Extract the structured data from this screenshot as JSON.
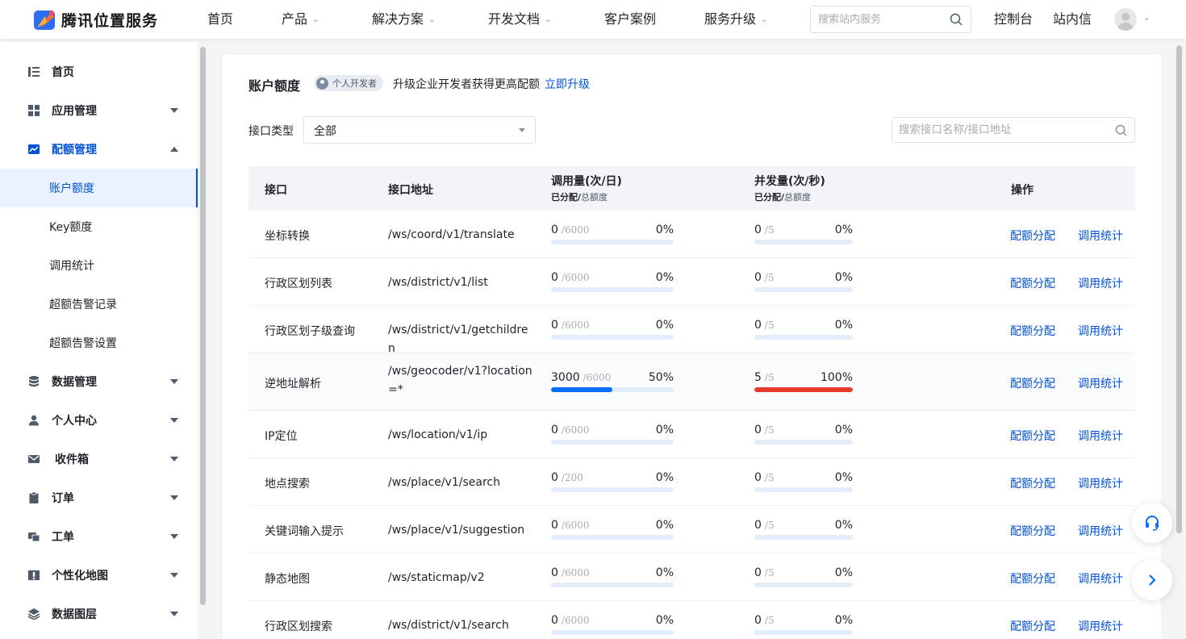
{
  "brand": {
    "name": "腾讯位置服务"
  },
  "topnav": {
    "items": [
      {
        "label": "首页",
        "has_dropdown": false
      },
      {
        "label": "产品",
        "has_dropdown": true
      },
      {
        "label": "解决方案",
        "has_dropdown": true
      },
      {
        "label": "开发文档",
        "has_dropdown": true
      },
      {
        "label": "客户案例",
        "has_dropdown": false
      },
      {
        "label": "服务升级",
        "has_dropdown": true
      }
    ],
    "search_placeholder": "搜索站内服务",
    "console_label": "控制台",
    "inbox_label": "站内信"
  },
  "sidebar": {
    "items": [
      {
        "label": "首页",
        "icon": "list-icon"
      },
      {
        "label": "应用管理",
        "icon": "grid-icon"
      },
      {
        "label": "配额管理",
        "icon": "quota-chart-icon",
        "expanded": true
      },
      {
        "label": "数据管理",
        "icon": "database-icon"
      },
      {
        "label": "个人中心",
        "icon": "user-icon"
      },
      {
        "label": "收件箱",
        "icon": "mail-icon"
      },
      {
        "label": "订单",
        "icon": "clipboard-icon"
      },
      {
        "label": "工单",
        "icon": "ticket-icon"
      },
      {
        "label": "个性化地图",
        "icon": "custom-map-icon"
      },
      {
        "label": "数据图层",
        "icon": "layers-icon"
      }
    ],
    "subitems": [
      {
        "label": "账户额度",
        "active": true
      },
      {
        "label": "Key额度"
      },
      {
        "label": "调用统计"
      },
      {
        "label": "超额告警记录"
      },
      {
        "label": "超额告警设置"
      }
    ]
  },
  "page": {
    "title": "账户额度",
    "badge": "个人开发者",
    "upgrade_text": "升级企业开发者获得更高配额",
    "upgrade_link": "立即升级",
    "filter_label": "接口类型",
    "filter_value": "全部",
    "api_search_placeholder": "搜索接口名称/接口地址"
  },
  "table": {
    "headers": {
      "api": "接口",
      "path": "接口地址",
      "daily": "调用量(次/日)",
      "daily_sub_bold": "已分配/",
      "daily_sub": "总额度",
      "concurrent": "并发量(次/秒)",
      "concurrent_sub_bold": "已分配/",
      "concurrent_sub": "总额度",
      "ops": "操作"
    },
    "op_allocate": "配额分配",
    "op_stats": "调用统计",
    "rows": [
      {
        "name": "坐标转换",
        "path": "/ws/coord/v1/translate",
        "daily_used": "0",
        "daily_total": "/6000",
        "daily_pct": "0%",
        "daily_ratio": 0,
        "conc_used": "0",
        "conc_total": "/5",
        "conc_pct": "0%",
        "conc_ratio": 0
      },
      {
        "name": "行政区划列表",
        "path": "/ws/district/v1/list",
        "daily_used": "0",
        "daily_total": "/6000",
        "daily_pct": "0%",
        "daily_ratio": 0,
        "conc_used": "0",
        "conc_total": "/5",
        "conc_pct": "0%",
        "conc_ratio": 0
      },
      {
        "name": "行政区划子级查询",
        "path": "/ws/district/v1/getchildren",
        "daily_used": "0",
        "daily_total": "/6000",
        "daily_pct": "0%",
        "daily_ratio": 0,
        "conc_used": "0",
        "conc_total": "/5",
        "conc_pct": "0%",
        "conc_ratio": 0
      },
      {
        "name": "逆地址解析",
        "path": "/ws/geocoder/v1?location=*",
        "daily_used": "3000",
        "daily_total": "/6000",
        "daily_pct": "50%",
        "daily_ratio": 0.5,
        "conc_used": "5",
        "conc_total": "/5",
        "conc_pct": "100%",
        "conc_ratio": 1.0
      },
      {
        "name": "IP定位",
        "path": "/ws/location/v1/ip",
        "daily_used": "0",
        "daily_total": "/6000",
        "daily_pct": "0%",
        "daily_ratio": 0,
        "conc_used": "0",
        "conc_total": "/5",
        "conc_pct": "0%",
        "conc_ratio": 0
      },
      {
        "name": "地点搜索",
        "path": "/ws/place/v1/search",
        "daily_used": "0",
        "daily_total": "/200",
        "daily_pct": "0%",
        "daily_ratio": 0,
        "conc_used": "0",
        "conc_total": "/5",
        "conc_pct": "0%",
        "conc_ratio": 0
      },
      {
        "name": "关键词输入提示",
        "path": "/ws/place/v1/suggestion",
        "daily_used": "0",
        "daily_total": "/6000",
        "daily_pct": "0%",
        "daily_ratio": 0,
        "conc_used": "0",
        "conc_total": "/5",
        "conc_pct": "0%",
        "conc_ratio": 0
      },
      {
        "name": "静态地图",
        "path": "/ws/staticmap/v2",
        "daily_used": "0",
        "daily_total": "/6000",
        "daily_pct": "0%",
        "daily_ratio": 0,
        "conc_used": "0",
        "conc_total": "/5",
        "conc_pct": "0%",
        "conc_ratio": 0
      },
      {
        "name": "行政区划搜索",
        "path": "/ws/district/v1/search",
        "daily_used": "0",
        "daily_total": "/6000",
        "daily_pct": "0%",
        "daily_ratio": 0,
        "conc_used": "0",
        "conc_total": "/5",
        "conc_pct": "0%",
        "conc_ratio": 0
      }
    ]
  },
  "colors": {
    "accent": "#0052d9",
    "bar_track": "#e3ecfb",
    "bar_normal": "#0a6cff",
    "bar_full": "#e5392b"
  },
  "float_buttons": [
    {
      "icon": "headset-icon"
    },
    {
      "icon": "chevron-right-icon"
    }
  ]
}
